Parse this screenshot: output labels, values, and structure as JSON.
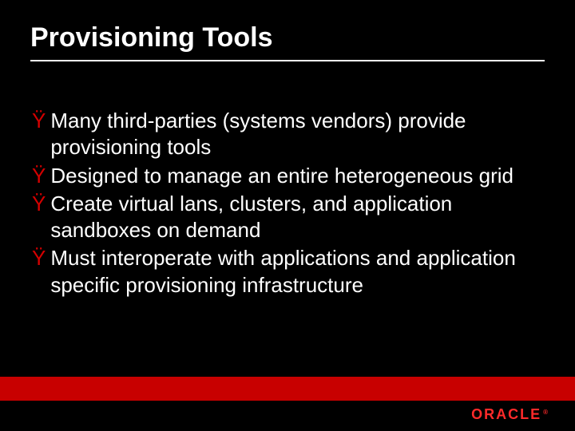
{
  "title": "Provisioning Tools",
  "bullet_marker": "Ÿ",
  "bullets": [
    {
      "text": "Many third-parties (systems vendors) provide provisioning tools"
    },
    {
      "text": "Designed to manage an entire heterogeneous grid"
    },
    {
      "text": "Create virtual lans, clusters, and application sandboxes on demand"
    },
    {
      "text": "Must interoperate with applications and application specific provisioning infrastructure"
    }
  ],
  "brand": "ORACLE",
  "brand_reg": "®",
  "colors": {
    "background": "#000000",
    "text": "#ffffff",
    "accent": "#c80000",
    "bullet": "#d40000"
  }
}
